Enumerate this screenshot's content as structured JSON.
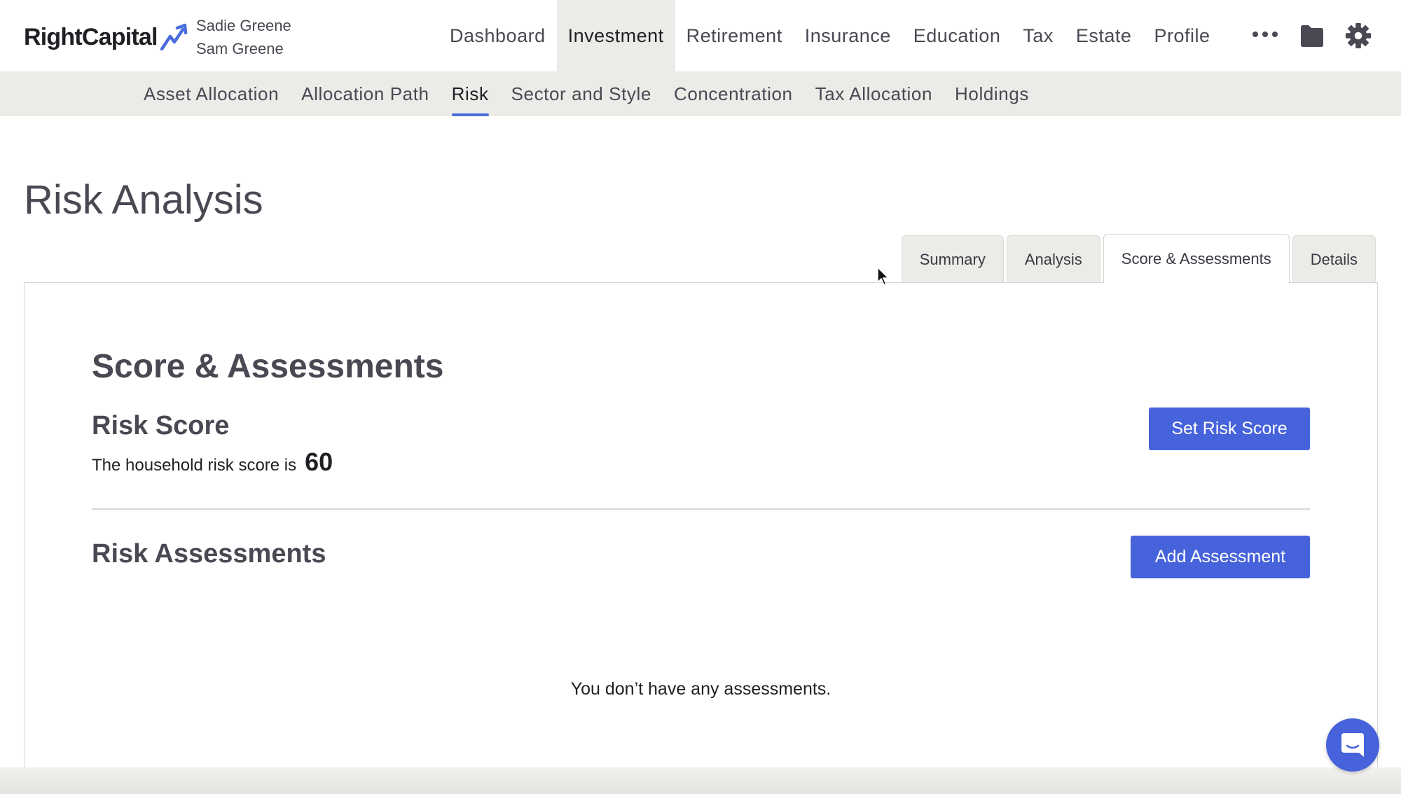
{
  "brand": {
    "logo_text": "RightCapital",
    "accent": "#4a6cdc",
    "button_color": "#4763db"
  },
  "clients": [
    "Sadie Greene",
    "Sam Greene"
  ],
  "main_nav": {
    "items": [
      "Dashboard",
      "Investment",
      "Retirement",
      "Insurance",
      "Education",
      "Tax",
      "Estate",
      "Profile"
    ],
    "active": "Investment",
    "icons": [
      "more-icon",
      "folder-icon",
      "gear-icon"
    ]
  },
  "sub_nav": {
    "items": [
      "Asset Allocation",
      "Allocation Path",
      "Risk",
      "Sector and Style",
      "Concentration",
      "Tax Allocation",
      "Holdings"
    ],
    "active": "Risk"
  },
  "page": {
    "title": "Risk Analysis"
  },
  "tabs": {
    "items": [
      "Summary",
      "Analysis",
      "Score & Assessments",
      "Details"
    ],
    "active": "Score & Assessments"
  },
  "panel": {
    "title": "Score & Assessments",
    "risk_score": {
      "heading": "Risk Score",
      "text": "The household risk score is",
      "value": "60",
      "button": "Set Risk Score"
    },
    "assessments": {
      "heading": "Risk Assessments",
      "button": "Add Assessment",
      "empty_text": "You don’t have any assessments."
    }
  },
  "chat": {
    "icon": "chat-icon"
  }
}
